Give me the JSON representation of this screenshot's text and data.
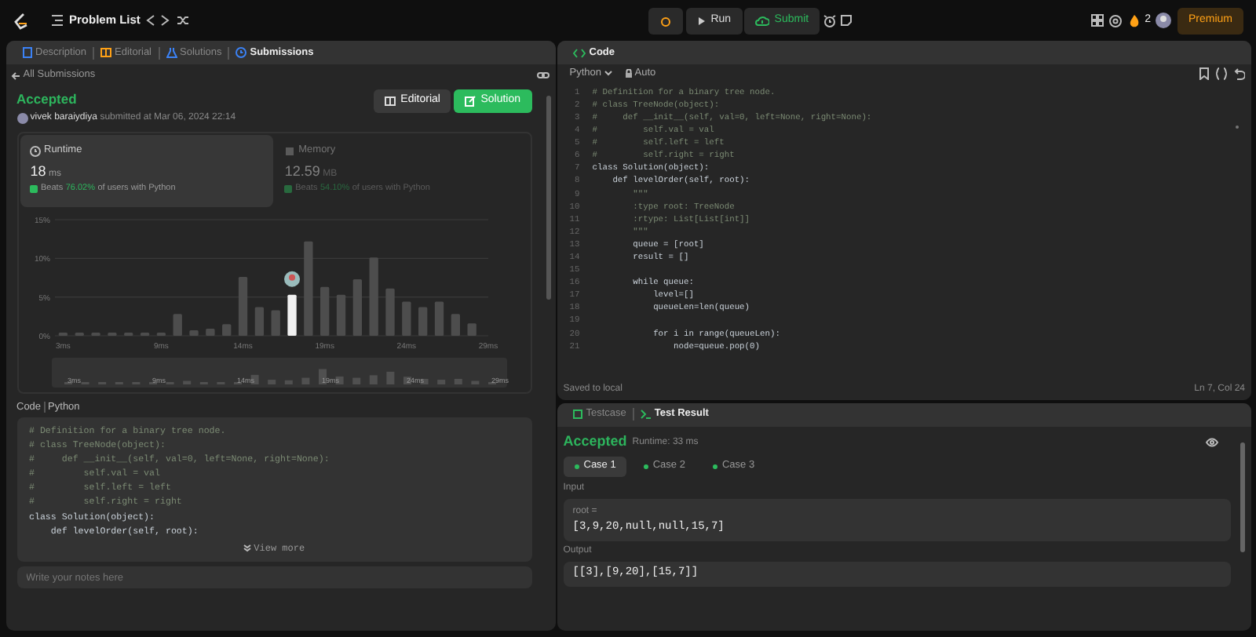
{
  "nav": {
    "problem_list": "Problem List",
    "run": "Run",
    "submit": "Submit",
    "streak": "2",
    "premium": "Premium"
  },
  "left_panel": {
    "tabs": [
      {
        "label": "Description",
        "selected": false
      },
      {
        "label": "Editorial",
        "selected": false
      },
      {
        "label": "Solutions",
        "selected": false
      },
      {
        "label": "Submissions",
        "selected": true
      }
    ],
    "back_link": "All Submissions",
    "submission": {
      "status": "Accepted",
      "user": "vivek baraiydiya",
      "submitted": "submitted at Mar 06, 2024 22:14",
      "buttons": [
        "Editorial",
        "Solution"
      ]
    },
    "metrics": [
      {
        "label": "Runtime",
        "value": "18",
        "unit": "ms",
        "beats": "Beats",
        "percent": "76.02%",
        "suffix": "of users with Python",
        "selected": true
      },
      {
        "label": "Memory",
        "value": "12.59",
        "unit": "MB",
        "beats": "Beats",
        "percent": "54.10%",
        "suffix": "of users with Python",
        "selected": false
      }
    ],
    "chart_data": {
      "type": "bar",
      "x": [
        3,
        4,
        5,
        6,
        7,
        8,
        9,
        10,
        11,
        12,
        13,
        14,
        15,
        16,
        17,
        18,
        19,
        20,
        21,
        22,
        23,
        24,
        25,
        26,
        27,
        28
      ],
      "values": [
        0.4,
        0.4,
        0.4,
        0.4,
        0.4,
        0.4,
        0.4,
        2.8,
        0.7,
        0.9,
        1.5,
        7.6,
        3.7,
        3.3,
        5.3,
        12.2,
        6.3,
        5.3,
        7.3,
        10.1,
        6.1,
        4.4,
        3.7,
        4.4,
        2.8,
        1.6
      ],
      "ylim": [
        0,
        15
      ],
      "yticks": [
        {
          "value": 0,
          "label": "0%"
        },
        {
          "value": 5,
          "label": "5%"
        },
        {
          "value": 10,
          "label": "10%"
        },
        {
          "value": 15,
          "label": "15%"
        }
      ],
      "xticks": [
        {
          "value": 3,
          "label": "3ms"
        },
        {
          "value": 9,
          "label": "9ms"
        },
        {
          "value": 14,
          "label": "14ms"
        },
        {
          "value": 19,
          "label": "19ms"
        },
        {
          "value": 24,
          "label": "24ms"
        },
        {
          "value": 29,
          "label": "29ms"
        }
      ],
      "xlim": [
        2.5,
        29
      ]
    },
    "bars": [
      {
        "selected": false
      },
      {
        "selected": false
      },
      {
        "selected": false
      },
      {
        "selected": false
      },
      {
        "selected": false
      },
      {
        "selected": false
      },
      {
        "selected": false
      },
      {
        "selected": false
      },
      {
        "selected": false
      },
      {
        "selected": false
      },
      {
        "selected": false
      },
      {
        "selected": false
      },
      {
        "selected": false
      },
      {
        "selected": false
      },
      {
        "selected": true
      },
      {
        "selected": false
      },
      {
        "selected": false
      },
      {
        "selected": false
      },
      {
        "selected": false
      },
      {
        "selected": false
      },
      {
        "selected": false
      },
      {
        "selected": false
      },
      {
        "selected": false
      },
      {
        "selected": false
      },
      {
        "selected": false
      },
      {
        "selected": false
      }
    ],
    "overview_labels": [
      "3ms",
      "9ms",
      "14ms",
      "19ms",
      "24ms",
      "29ms"
    ],
    "code_header": {
      "label": "Code",
      "language": "Python"
    },
    "code_lines": [
      {
        "text": "# Definition for a binary tree node.",
        "kind": "comment"
      },
      {
        "text": "# class TreeNode(object):",
        "kind": "comment"
      },
      {
        "text": "#     def __init__(self, val=0, left=None, right=None):",
        "kind": "comment"
      },
      {
        "text": "#         self.val = val",
        "kind": "comment"
      },
      {
        "text": "#         self.left = left",
        "kind": "comment"
      },
      {
        "text": "#         self.right = right",
        "kind": "comment"
      },
      {
        "text": "class Solution(object):",
        "kind": "code"
      },
      {
        "text": "    def levelOrder(self, root):",
        "kind": "code"
      }
    ],
    "view_more": "View more",
    "notes": {
      "placeholder": "Write your notes here"
    }
  },
  "editor": {
    "tab": "Code",
    "language": "Python",
    "mode": "Auto",
    "lines": [
      {
        "number": "1",
        "text": "# Definition for a binary tree node.",
        "kind": "comment"
      },
      {
        "number": "2",
        "text": "# class TreeNode(object):",
        "kind": "comment"
      },
      {
        "number": "3",
        "text": "#     def __init__(self, val=0, left=None, right=None):",
        "kind": "comment"
      },
      {
        "number": "4",
        "text": "#         self.val = val",
        "kind": "comment"
      },
      {
        "number": "5",
        "text": "#         self.left = left",
        "kind": "comment"
      },
      {
        "number": "6",
        "text": "#         self.right = right",
        "kind": "comment"
      },
      {
        "number": "7",
        "text": "class Solution(object):",
        "kind": "code"
      },
      {
        "number": "8",
        "text": "    def levelOrder(self, root):",
        "kind": "code"
      },
      {
        "number": "9",
        "text": "        \"\"\"",
        "kind": "comment"
      },
      {
        "number": "10",
        "text": "        :type root: TreeNode",
        "kind": "comment"
      },
      {
        "number": "11",
        "text": "        :rtype: List[List[int]]",
        "kind": "comment"
      },
      {
        "number": "12",
        "text": "        \"\"\"",
        "kind": "comment"
      },
      {
        "number": "13",
        "text": "        queue = [root]",
        "kind": "code"
      },
      {
        "number": "14",
        "text": "        result = []",
        "kind": "code"
      },
      {
        "number": "15"
      },
      {
        "number": "16",
        "text": "        while queue:",
        "kind": "code"
      },
      {
        "number": "17",
        "text": "            level=[]",
        "kind": "code"
      },
      {
        "number": "18",
        "text": "            queueLen=len(queue)",
        "kind": "code"
      },
      {
        "number": "19"
      },
      {
        "number": "20",
        "text": "            for i in range(queueLen):",
        "kind": "code"
      },
      {
        "number": "21",
        "text": "                node=queue.pop(0)",
        "kind": "code"
      }
    ],
    "saved": "Saved to local",
    "cursor": "Ln 7, Col 24"
  },
  "result": {
    "tabs": [
      {
        "label": "Testcase",
        "selected": false
      },
      {
        "label": "Test Result",
        "selected": true
      }
    ],
    "status": "Accepted",
    "runtime": "Runtime: 33 ms",
    "cases": [
      {
        "label": "Case 1",
        "selected": true,
        "passed": true
      },
      {
        "label": "Case 2",
        "selected": false,
        "passed": true
      },
      {
        "label": "Case 3",
        "selected": false,
        "passed": true
      }
    ],
    "input_label": "Input",
    "param": "root =",
    "input": "[3,9,20,null,null,15,7]",
    "output_label": "Output",
    "output": "[[3],[9,20],[15,7]]"
  }
}
